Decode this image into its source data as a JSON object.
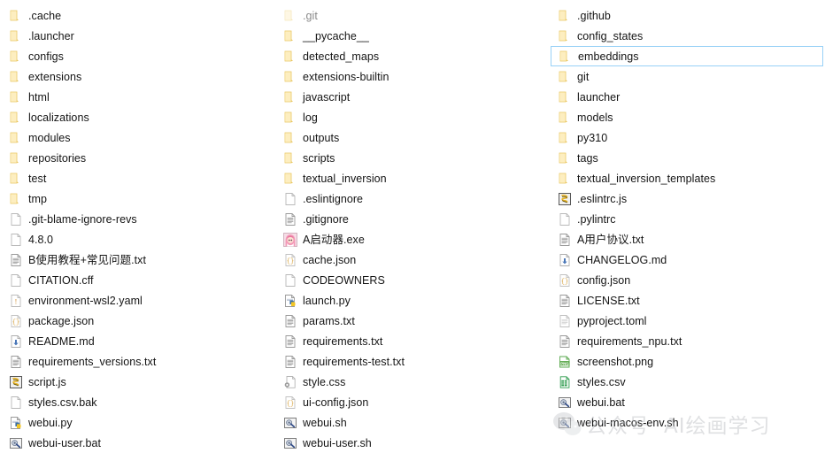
{
  "window": {
    "view": "large-list",
    "selected_item": "embeddings",
    "selection_border_color": "#99d1f7",
    "background_color": "#ffffff"
  },
  "watermark": {
    "logo": "wechat-icon",
    "text_primary": "公众号",
    "text_secondary": "AI绘画学习"
  },
  "columns": [
    {
      "index": 0,
      "items": [
        {
          "name": ".cache",
          "icon": "folder-icon",
          "type": "folder",
          "selected": false,
          "dim": false
        },
        {
          "name": ".launcher",
          "icon": "folder-icon",
          "type": "folder",
          "selected": false,
          "dim": false
        },
        {
          "name": "configs",
          "icon": "folder-icon",
          "type": "folder",
          "selected": false,
          "dim": false
        },
        {
          "name": "extensions",
          "icon": "folder-icon",
          "type": "folder",
          "selected": false,
          "dim": false
        },
        {
          "name": "html",
          "icon": "folder-icon",
          "type": "folder",
          "selected": false,
          "dim": false
        },
        {
          "name": "localizations",
          "icon": "folder-icon",
          "type": "folder",
          "selected": false,
          "dim": false
        },
        {
          "name": "modules",
          "icon": "folder-icon",
          "type": "folder",
          "selected": false,
          "dim": false
        },
        {
          "name": "repositories",
          "icon": "folder-icon",
          "type": "folder",
          "selected": false,
          "dim": false
        },
        {
          "name": "test",
          "icon": "folder-icon",
          "type": "folder",
          "selected": false,
          "dim": false
        },
        {
          "name": "tmp",
          "icon": "folder-icon",
          "type": "folder",
          "selected": false,
          "dim": false
        },
        {
          "name": ".git-blame-ignore-revs",
          "icon": "blank-file-icon",
          "type": "file",
          "selected": false,
          "dim": false
        },
        {
          "name": "4.8.0",
          "icon": "blank-file-icon",
          "type": "file",
          "selected": false,
          "dim": false
        },
        {
          "name": "B使用教程+常见问题.txt",
          "icon": "text-file-icon",
          "type": "file",
          "selected": false,
          "dim": false
        },
        {
          "name": "CITATION.cff",
          "icon": "blank-file-icon",
          "type": "file",
          "selected": false,
          "dim": false
        },
        {
          "name": "environment-wsl2.yaml",
          "icon": "yaml-file-icon",
          "type": "file",
          "selected": false,
          "dim": false
        },
        {
          "name": "package.json",
          "icon": "json-file-icon",
          "type": "file",
          "selected": false,
          "dim": false
        },
        {
          "name": "README.md",
          "icon": "markdown-file-icon",
          "type": "file",
          "selected": false,
          "dim": false
        },
        {
          "name": "requirements_versions.txt",
          "icon": "text-file-icon",
          "type": "file",
          "selected": false,
          "dim": false
        },
        {
          "name": "script.js",
          "icon": "javascript-file-icon",
          "type": "file",
          "selected": false,
          "dim": false
        },
        {
          "name": "styles.csv.bak",
          "icon": "blank-file-icon",
          "type": "file",
          "selected": false,
          "dim": false
        },
        {
          "name": "webui.py",
          "icon": "python-file-icon",
          "type": "file",
          "selected": false,
          "dim": false
        },
        {
          "name": "webui-user.bat",
          "icon": "batch-file-icon",
          "type": "file",
          "selected": false,
          "dim": false
        }
      ]
    },
    {
      "index": 1,
      "items": [
        {
          "name": ".git",
          "icon": "folder-icon",
          "type": "folder",
          "selected": false,
          "dim": true
        },
        {
          "name": "__pycache__",
          "icon": "folder-icon",
          "type": "folder",
          "selected": false,
          "dim": false
        },
        {
          "name": "detected_maps",
          "icon": "folder-icon",
          "type": "folder",
          "selected": false,
          "dim": false
        },
        {
          "name": "extensions-builtin",
          "icon": "folder-icon",
          "type": "folder",
          "selected": false,
          "dim": false
        },
        {
          "name": "javascript",
          "icon": "folder-icon",
          "type": "folder",
          "selected": false,
          "dim": false
        },
        {
          "name": "log",
          "icon": "folder-icon",
          "type": "folder",
          "selected": false,
          "dim": false
        },
        {
          "name": "outputs",
          "icon": "folder-icon",
          "type": "folder",
          "selected": false,
          "dim": false
        },
        {
          "name": "scripts",
          "icon": "folder-icon",
          "type": "folder",
          "selected": false,
          "dim": false
        },
        {
          "name": "textual_inversion",
          "icon": "folder-icon",
          "type": "folder",
          "selected": false,
          "dim": false
        },
        {
          "name": ".eslintignore",
          "icon": "blank-file-icon",
          "type": "file",
          "selected": false,
          "dim": false
        },
        {
          "name": ".gitignore",
          "icon": "text-file-icon",
          "type": "file",
          "selected": false,
          "dim": false
        },
        {
          "name": "A启动器.exe",
          "icon": "anime-app-icon",
          "type": "file",
          "selected": false,
          "dim": false
        },
        {
          "name": "cache.json",
          "icon": "json-file-icon",
          "type": "file",
          "selected": false,
          "dim": false
        },
        {
          "name": "CODEOWNERS",
          "icon": "blank-file-icon",
          "type": "file",
          "selected": false,
          "dim": false
        },
        {
          "name": "launch.py",
          "icon": "python-file-icon",
          "type": "file",
          "selected": false,
          "dim": false
        },
        {
          "name": "params.txt",
          "icon": "text-file-icon",
          "type": "file",
          "selected": false,
          "dim": false
        },
        {
          "name": "requirements.txt",
          "icon": "text-file-icon",
          "type": "file",
          "selected": false,
          "dim": false
        },
        {
          "name": "requirements-test.txt",
          "icon": "text-file-icon",
          "type": "file",
          "selected": false,
          "dim": false
        },
        {
          "name": "style.css",
          "icon": "css-file-icon",
          "type": "file",
          "selected": false,
          "dim": false
        },
        {
          "name": "ui-config.json",
          "icon": "json-file-icon",
          "type": "file",
          "selected": false,
          "dim": false
        },
        {
          "name": "webui.sh",
          "icon": "shell-file-icon",
          "type": "file",
          "selected": false,
          "dim": false
        },
        {
          "name": "webui-user.sh",
          "icon": "shell-file-icon",
          "type": "file",
          "selected": false,
          "dim": false
        }
      ]
    },
    {
      "index": 2,
      "items": [
        {
          "name": ".github",
          "icon": "folder-icon",
          "type": "folder",
          "selected": false,
          "dim": false
        },
        {
          "name": "config_states",
          "icon": "folder-icon",
          "type": "folder",
          "selected": false,
          "dim": false
        },
        {
          "name": "embeddings",
          "icon": "folder-icon",
          "type": "folder",
          "selected": true,
          "dim": false
        },
        {
          "name": "git",
          "icon": "folder-icon",
          "type": "folder",
          "selected": false,
          "dim": false
        },
        {
          "name": "launcher",
          "icon": "folder-icon",
          "type": "folder",
          "selected": false,
          "dim": false
        },
        {
          "name": "models",
          "icon": "folder-icon",
          "type": "folder",
          "selected": false,
          "dim": false
        },
        {
          "name": "py310",
          "icon": "folder-icon",
          "type": "folder",
          "selected": false,
          "dim": false
        },
        {
          "name": "tags",
          "icon": "folder-icon",
          "type": "folder",
          "selected": false,
          "dim": false
        },
        {
          "name": "textual_inversion_templates",
          "icon": "folder-icon",
          "type": "folder",
          "selected": false,
          "dim": false
        },
        {
          "name": ".eslintrc.js",
          "icon": "javascript-file-icon",
          "type": "file",
          "selected": false,
          "dim": false
        },
        {
          "name": ".pylintrc",
          "icon": "blank-file-icon",
          "type": "file",
          "selected": false,
          "dim": false
        },
        {
          "name": "A用户协议.txt",
          "icon": "text-file-icon",
          "type": "file",
          "selected": false,
          "dim": false
        },
        {
          "name": "CHANGELOG.md",
          "icon": "markdown-file-icon",
          "type": "file",
          "selected": false,
          "dim": false
        },
        {
          "name": "config.json",
          "icon": "json-file-icon",
          "type": "file",
          "selected": false,
          "dim": false
        },
        {
          "name": "LICENSE.txt",
          "icon": "text-file-icon",
          "type": "file",
          "selected": false,
          "dim": false
        },
        {
          "name": "pyproject.toml",
          "icon": "text-light-file-icon",
          "type": "file",
          "selected": false,
          "dim": false
        },
        {
          "name": "requirements_npu.txt",
          "icon": "text-file-icon",
          "type": "file",
          "selected": false,
          "dim": false
        },
        {
          "name": "screenshot.png",
          "icon": "png-file-icon",
          "type": "file",
          "selected": false,
          "dim": false
        },
        {
          "name": "styles.csv",
          "icon": "csv-file-icon",
          "type": "file",
          "selected": false,
          "dim": false
        },
        {
          "name": "webui.bat",
          "icon": "batch-file-icon",
          "type": "file",
          "selected": false,
          "dim": false
        },
        {
          "name": "webui-macos-env.sh",
          "icon": "shell-file-icon",
          "type": "file",
          "selected": false,
          "dim": false
        }
      ]
    }
  ]
}
